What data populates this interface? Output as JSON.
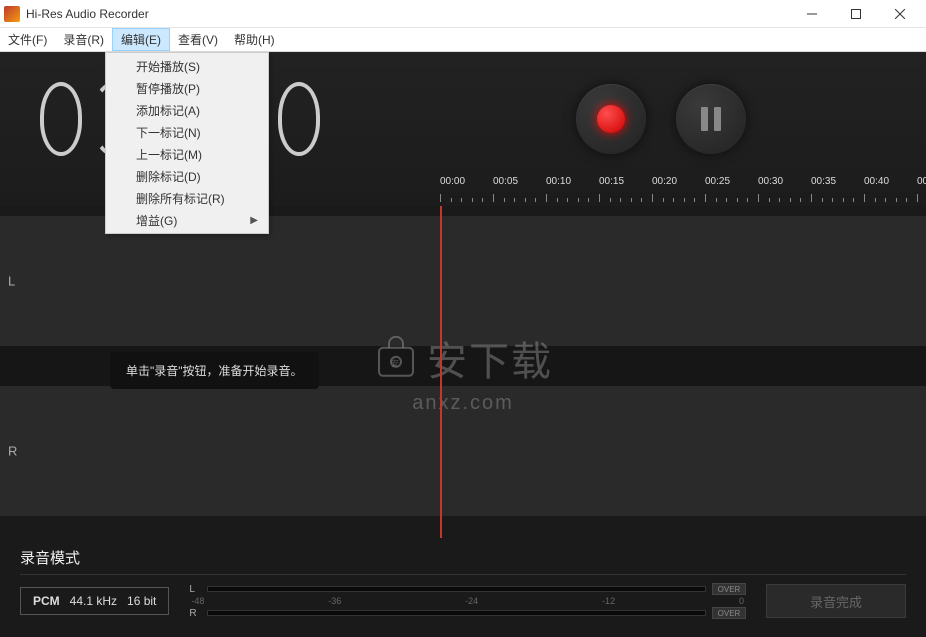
{
  "window": {
    "title": "Hi-Res Audio Recorder"
  },
  "menubar": {
    "items": [
      {
        "label": "文件(F)"
      },
      {
        "label": "录音(R)"
      },
      {
        "label": "编辑(E)"
      },
      {
        "label": "查看(V)"
      },
      {
        "label": "帮助(H)"
      }
    ]
  },
  "edit_menu": {
    "items": [
      {
        "label": "开始播放(S)"
      },
      {
        "label": "暂停播放(P)"
      },
      {
        "label": "添加标记(A)"
      },
      {
        "label": "下一标记(N)"
      },
      {
        "label": "上一标记(M)"
      },
      {
        "label": "删除标记(D)"
      },
      {
        "label": "删除所有标记(R)"
      },
      {
        "label": "增益(G)",
        "has_submenu": true
      }
    ]
  },
  "timeline": {
    "labels": [
      "00:00",
      "00:05",
      "00:10",
      "00:15",
      "00:20",
      "00:25",
      "00:30",
      "00:35",
      "00:40",
      "00"
    ]
  },
  "channels": {
    "left": "L",
    "right": "R"
  },
  "hint": {
    "text": "单击\"录音\"按钮，准备开始录音。"
  },
  "watermark": {
    "main": "安下载",
    "sub": "anxz.com"
  },
  "bottom": {
    "mode_title": "录音模式",
    "format_codec": "PCM",
    "format_rate": "44.1 kHz",
    "format_bits": "16 bit",
    "meter_scale": [
      "-48",
      "-36",
      "-24",
      "-12",
      "0"
    ],
    "over": "OVER",
    "L": "L",
    "R": "R",
    "finish": "录音完成"
  }
}
